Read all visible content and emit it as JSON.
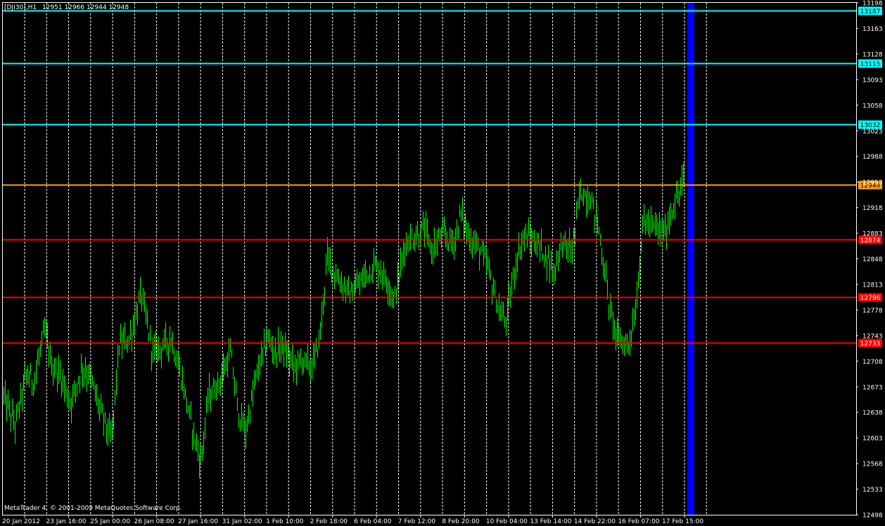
{
  "header": {
    "symbol": "[DJI30],H1",
    "ohlc": "12951 12966 12944 12948"
  },
  "footer": {
    "copyright": "MetaTrader 4, © 2001-2009 MetaQuotes Software Corp."
  },
  "colors": {
    "background": "#000000",
    "candle": "#00ff00",
    "grid": "#ffffff",
    "axis": "#ffffff",
    "level_cyan": "#00ffff",
    "level_orange": "#ffa500",
    "level_red": "#ff0000",
    "current_bar": "#0000ff"
  },
  "chart_data": {
    "type": "ohlc",
    "symbol": "DJI30",
    "timeframe": "H1",
    "ylim": [
      12498,
      13198
    ],
    "y_ticks": [
      "13198",
      "13163",
      "13128",
      "13093",
      "13058",
      "13023",
      "12988",
      "12953",
      "12918",
      "12883",
      "12848",
      "12813",
      "12778",
      "12743",
      "12708",
      "12673",
      "12638",
      "12603",
      "12568",
      "12533",
      "12498"
    ],
    "x_ticks": [
      "20 Jan 2012",
      "23 Jan 16:00",
      "25 Jan 00:00",
      "26 Jan 08:00",
      "27 Jan 16:00",
      "31 Jan 02:00",
      "1 Feb 10:00",
      "2 Feb 18:00",
      "6 Feb 04:00",
      "7 Feb 12:00",
      "8 Feb 20:00",
      "10 Feb 04:00",
      "13 Feb 14:00",
      "14 Feb 22:00",
      "16 Feb 07:00",
      "17 Feb 15:00"
    ],
    "levels": [
      {
        "value": 13187,
        "label": "13187",
        "color": "cyan"
      },
      {
        "value": 13115,
        "label": "13115",
        "color": "cyan"
      },
      {
        "value": 13032,
        "label": "13032",
        "color": "cyan"
      },
      {
        "value": 12949,
        "label": "12949",
        "color": "orange"
      },
      {
        "value": 12874,
        "label": "12874",
        "color": "red"
      },
      {
        "value": 12796,
        "label": "12796",
        "color": "red"
      },
      {
        "value": 12733,
        "label": "12733",
        "color": "red"
      }
    ],
    "price_path": [
      [
        0,
        12660
      ],
      [
        3,
        12620
      ],
      [
        6,
        12690
      ],
      [
        8,
        12680
      ],
      [
        11,
        12750
      ],
      [
        13,
        12700
      ],
      [
        15,
        12690
      ],
      [
        18,
        12650
      ],
      [
        21,
        12700
      ],
      [
        23,
        12690
      ],
      [
        26,
        12640
      ],
      [
        29,
        12600
      ],
      [
        31,
        12730
      ],
      [
        34,
        12740
      ],
      [
        37,
        12800
      ],
      [
        40,
        12720
      ],
      [
        43,
        12730
      ],
      [
        45,
        12740
      ],
      [
        48,
        12680
      ],
      [
        51,
        12610
      ],
      [
        53,
        12570
      ],
      [
        55,
        12660
      ],
      [
        58,
        12680
      ],
      [
        61,
        12720
      ],
      [
        63,
        12640
      ],
      [
        65,
        12610
      ],
      [
        68,
        12690
      ],
      [
        71,
        12740
      ],
      [
        73,
        12720
      ],
      [
        75,
        12730
      ],
      [
        78,
        12700
      ],
      [
        80,
        12710
      ],
      [
        83,
        12700
      ],
      [
        85,
        12740
      ],
      [
        87,
        12850
      ],
      [
        90,
        12820
      ],
      [
        93,
        12800
      ],
      [
        95,
        12810
      ],
      [
        98,
        12830
      ],
      [
        100,
        12840
      ],
      [
        103,
        12820
      ],
      [
        105,
        12790
      ],
      [
        108,
        12870
      ],
      [
        111,
        12880
      ],
      [
        113,
        12890
      ],
      [
        115,
        12860
      ],
      [
        118,
        12880
      ],
      [
        121,
        12870
      ],
      [
        123,
        12910
      ],
      [
        125,
        12880
      ],
      [
        128,
        12860
      ],
      [
        130,
        12840
      ],
      [
        133,
        12780
      ],
      [
        135,
        12760
      ],
      [
        138,
        12850
      ],
      [
        140,
        12880
      ],
      [
        143,
        12870
      ],
      [
        145,
        12860
      ],
      [
        148,
        12830
      ],
      [
        150,
        12870
      ],
      [
        153,
        12860
      ],
      [
        155,
        12940
      ],
      [
        158,
        12930
      ],
      [
        160,
        12890
      ],
      [
        163,
        12780
      ],
      [
        165,
        12740
      ],
      [
        168,
        12730
      ],
      [
        170,
        12780
      ],
      [
        172,
        12900
      ],
      [
        175,
        12890
      ],
      [
        178,
        12885
      ],
      [
        180,
        12920
      ],
      [
        182,
        12940
      ],
      [
        183,
        12960
      ]
    ],
    "price_path_x_max": 183
  }
}
